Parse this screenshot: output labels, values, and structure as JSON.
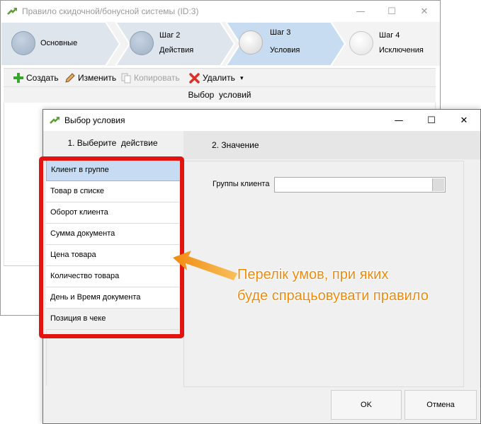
{
  "main_window": {
    "title": "Правило скидочной/бонусной системы (ID:3)",
    "minimize": "—",
    "maximize": "☐",
    "close": "✕"
  },
  "wizard": {
    "steps": [
      {
        "prefix": "",
        "label": "Основные",
        "state": "done"
      },
      {
        "prefix": "Шаг 2",
        "label": "Действия",
        "state": "done"
      },
      {
        "prefix": "Шаг 3",
        "label": "Условия",
        "state": "active"
      },
      {
        "prefix": "Шаг 4",
        "label": "Исключения",
        "state": "pending"
      }
    ]
  },
  "toolbar": {
    "create": "Создать",
    "edit": "Изменить",
    "copy": "Копировать",
    "delete": "Удалить",
    "more": "▾"
  },
  "conditions_header": "Выбор  условий",
  "dialog": {
    "title": "Выбор условия",
    "minimize": "—",
    "maximize": "☐",
    "close": "✕",
    "left_header": "1. Выберите  действие",
    "right_header": "2. Значение",
    "conditions": [
      {
        "label": "Клиент в группе",
        "selected": true
      },
      {
        "label": "Товар в списке",
        "selected": false
      },
      {
        "label": "Оборот клиента",
        "selected": false
      },
      {
        "label": "Сумма документа",
        "selected": false
      },
      {
        "label": "Цена товара",
        "selected": false
      },
      {
        "label": "Количество товара",
        "selected": false
      },
      {
        "label": "День и Время документа",
        "selected": false
      },
      {
        "label": "Позиция в чеке",
        "selected": false
      }
    ],
    "group_label": "Группы клиента",
    "group_value": "",
    "ok": "OK",
    "cancel": "Отмена"
  },
  "annotation": {
    "line1": "Перелік умов, при яких",
    "line2": "буде спрацьовувати правило",
    "color": "#ef8a0f",
    "box_color": "#e3130f"
  }
}
